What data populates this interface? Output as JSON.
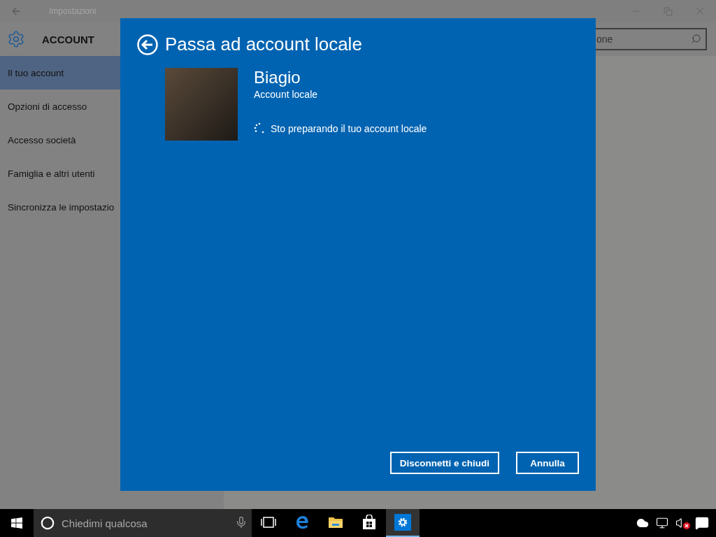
{
  "window": {
    "title": "Impostazioni"
  },
  "header": {
    "title": "ACCOUNT"
  },
  "search": {
    "placeholder": "one"
  },
  "sidebar": {
    "items": [
      {
        "label": "Il tuo account",
        "selected": true
      },
      {
        "label": "Opzioni di accesso",
        "selected": false
      },
      {
        "label": "Accesso società",
        "selected": false
      },
      {
        "label": "Famiglia e altri utenti",
        "selected": false
      },
      {
        "label": "Sincronizza le impostazio",
        "selected": false
      }
    ]
  },
  "dialog": {
    "title": "Passa ad account locale",
    "user": {
      "name": "Biagio",
      "account_type": "Account locale"
    },
    "status": "Sto preparando il tuo account locale",
    "buttons": [
      {
        "label": "Disconnetti e chiudi"
      },
      {
        "label": "Annulla"
      }
    ]
  },
  "taskbar": {
    "search": {
      "placeholder": "Chiedimi qualcosa"
    },
    "apps": [
      {
        "kind": "task-view",
        "selected": false
      },
      {
        "kind": "browser",
        "selected": false
      },
      {
        "kind": "folder",
        "selected": false
      },
      {
        "kind": "store",
        "selected": false
      },
      {
        "kind": "settings",
        "selected": true
      }
    ]
  }
}
